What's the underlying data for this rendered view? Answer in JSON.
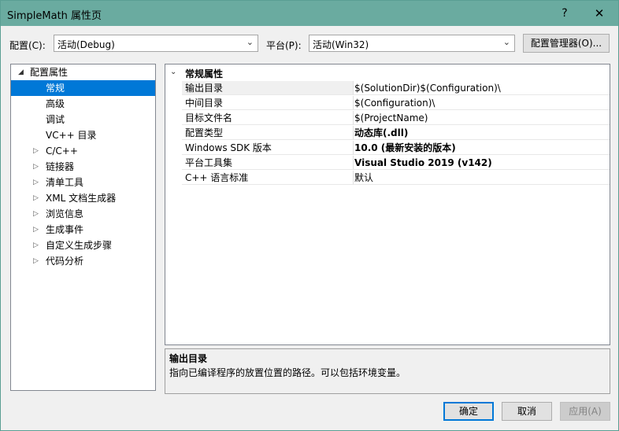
{
  "window": {
    "title": "SimpleMath 属性页",
    "help_label": "?",
    "close_label": "✕"
  },
  "toolbar": {
    "config_label": "配置(C):",
    "config_value": "活动(Debug)",
    "platform_label": "平台(P):",
    "platform_value": "活动(Win32)",
    "config_manager_label": "配置管理器(O)..."
  },
  "tree": {
    "root": "配置属性",
    "items": [
      {
        "label": "常规",
        "selected": true,
        "expandable": false
      },
      {
        "label": "高级",
        "expandable": false
      },
      {
        "label": "调试",
        "expandable": false
      },
      {
        "label": "VC++ 目录",
        "expandable": false
      },
      {
        "label": "C/C++",
        "expandable": true
      },
      {
        "label": "链接器",
        "expandable": true
      },
      {
        "label": "清单工具",
        "expandable": true
      },
      {
        "label": "XML 文档生成器",
        "expandable": true
      },
      {
        "label": "浏览信息",
        "expandable": true
      },
      {
        "label": "生成事件",
        "expandable": true
      },
      {
        "label": "自定义生成步骤",
        "expandable": true
      },
      {
        "label": "代码分析",
        "expandable": true
      }
    ]
  },
  "grid": {
    "category": "常规属性",
    "rows": [
      {
        "name": "输出目录",
        "value": "$(SolutionDir)$(Configuration)\\",
        "bold": false
      },
      {
        "name": "中间目录",
        "value": "$(Configuration)\\",
        "bold": false
      },
      {
        "name": "目标文件名",
        "value": "$(ProjectName)",
        "bold": false
      },
      {
        "name": "配置类型",
        "value": "动态库(.dll)",
        "bold": true
      },
      {
        "name": "Windows SDK 版本",
        "value": "10.0 (最新安装的版本)",
        "bold": true
      },
      {
        "name": "平台工具集",
        "value": "Visual Studio 2019 (v142)",
        "bold": true
      },
      {
        "name": "C++ 语言标准",
        "value": "默认",
        "bold": false
      }
    ]
  },
  "description": {
    "title": "输出目录",
    "text": "指向已编译程序的放置位置的路径。可以包括环境变量。"
  },
  "footer": {
    "ok_label": "确定",
    "cancel_label": "取消",
    "apply_label": "应用(A)"
  },
  "colors": {
    "titlebar": "#6aaba0",
    "selection": "#0078d7"
  }
}
